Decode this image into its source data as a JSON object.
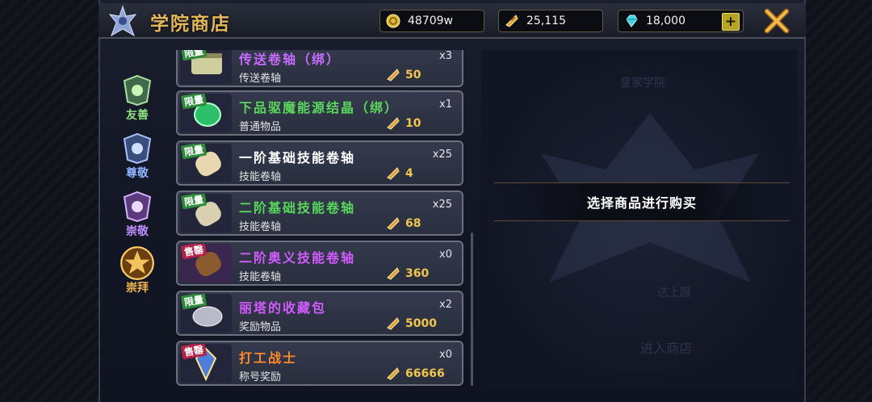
{
  "header": {
    "title": "学院商店",
    "currencies": {
      "gold": "48709w",
      "ticket": "25,115",
      "gem": "18,000"
    }
  },
  "tabs": [
    {
      "label": "友善"
    },
    {
      "label": "尊敬"
    },
    {
      "label": "崇敬"
    },
    {
      "label": "崇拜"
    }
  ],
  "items": [
    {
      "badge": "限量",
      "name": "传送卷轴（绑）",
      "type": "传送卷轴",
      "qty": "x3",
      "price": "50",
      "name_color": "#c86cff"
    },
    {
      "badge": "限量",
      "name": "下品驱魔能源结晶（绑）",
      "type": "普通物品",
      "qty": "x1",
      "price": "10",
      "name_color": "#59d75c"
    },
    {
      "badge": "限量",
      "name": "一阶基础技能卷轴",
      "type": "技能卷轴",
      "qty": "x25",
      "price": "4",
      "name_color": "#ffffff"
    },
    {
      "badge": "限量",
      "name": "二阶基础技能卷轴",
      "type": "技能卷轴",
      "qty": "x25",
      "price": "68",
      "name_color": "#59d75c"
    },
    {
      "badge": "售罄",
      "name": "二阶奥义技能卷轴",
      "type": "技能卷轴",
      "qty": "x0",
      "price": "360",
      "name_color": "#d25bff"
    },
    {
      "badge": "限量",
      "name": "丽塔的收藏包",
      "type": "奖励物品",
      "qty": "x2",
      "price": "5000",
      "name_color": "#d25bff"
    },
    {
      "badge": "售罄",
      "name": "打工战士",
      "type": "称号奖励",
      "qty": "x0",
      "price": "66666",
      "name_color": "#ff8a2a"
    }
  ],
  "right_panel": {
    "prompt": "选择商品进行购买",
    "ghost": {
      "title": "皇家学院",
      "limit": "达上限",
      "enter": "进入商店"
    }
  },
  "colors": {
    "title": "#e3b85c",
    "price": "#f1c64c"
  },
  "icons": [
    "emblem-icon",
    "gold-coin-icon",
    "ticket-icon",
    "gem-icon",
    "plus-icon",
    "close-icon"
  ]
}
